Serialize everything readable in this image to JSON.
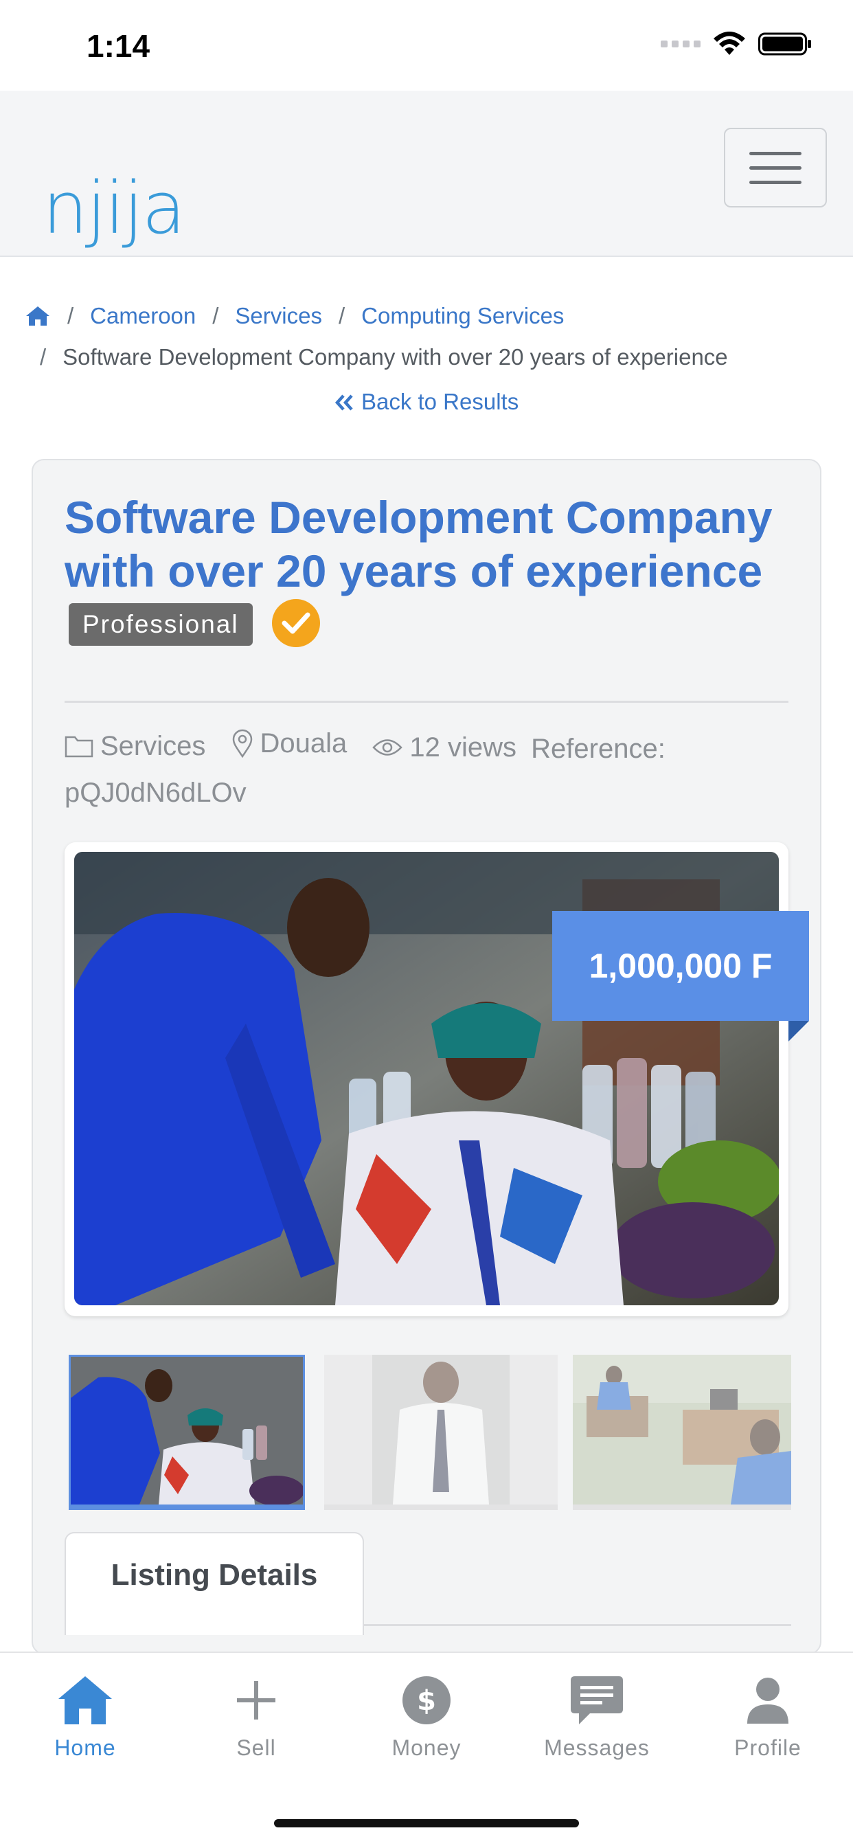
{
  "status_bar": {
    "time": "1:14"
  },
  "navbar": {
    "logo": "njija"
  },
  "breadcrumb": {
    "items": [
      "Cameroon",
      "Services",
      "Computing Services"
    ],
    "current": "Software Development Company with over 20 years of experience",
    "separator": "/"
  },
  "back_link": "Back to Results",
  "listing": {
    "title": "Software Development Company with over 20 years of experience",
    "badge": "Professional",
    "category": "Services",
    "location": "Douala",
    "views": "12 views",
    "reference_label": "Reference:",
    "reference": "pQJ0dN6dLOv",
    "price": "1,000,000 F",
    "tab": "Listing Details"
  },
  "bottom_nav": {
    "items": [
      {
        "label": "Home",
        "icon": "home-icon",
        "active": true
      },
      {
        "label": "Sell",
        "icon": "plus-icon",
        "active": false
      },
      {
        "label": "Money",
        "icon": "dollar-icon",
        "active": false
      },
      {
        "label": "Messages",
        "icon": "message-icon",
        "active": false
      },
      {
        "label": "Profile",
        "icon": "person-icon",
        "active": false
      }
    ]
  },
  "colors": {
    "brand_blue": "#3d75cc",
    "link_blue": "#3a77c8",
    "price_blue": "#5a8fe6",
    "verified_orange": "#f4a51c",
    "badge_gray": "#6b6b6b"
  }
}
